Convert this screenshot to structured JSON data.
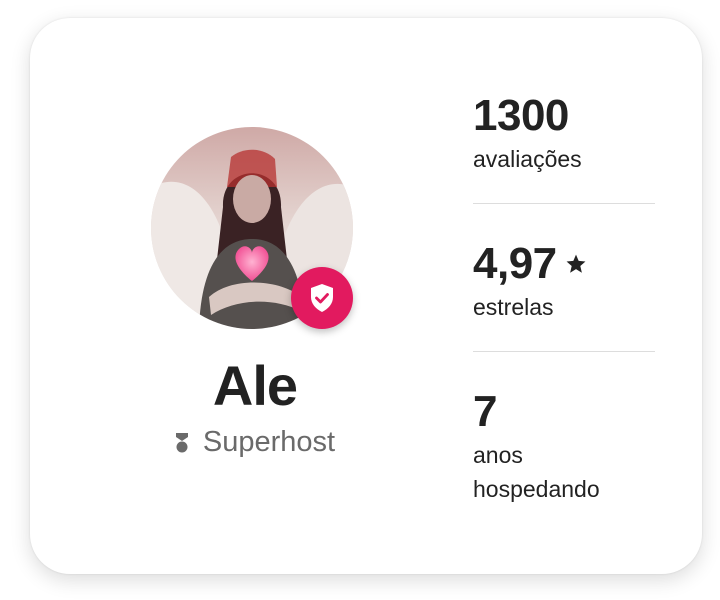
{
  "host": {
    "name": "Ale",
    "badge_label": "Superhost",
    "verified_icon": "shield-check-icon",
    "badge_icon": "superhost-medal-icon"
  },
  "stats": [
    {
      "value": "1300",
      "label": "avaliações"
    },
    {
      "value": "4,97",
      "label": "estrelas",
      "icon": "star-icon"
    },
    {
      "value": "7",
      "label_line1": "anos",
      "label_line2": "hospedando"
    }
  ],
  "colors": {
    "accent": "#e21a5f",
    "text": "#222222",
    "muted": "#6a6a6a",
    "divider": "#dddddd"
  }
}
